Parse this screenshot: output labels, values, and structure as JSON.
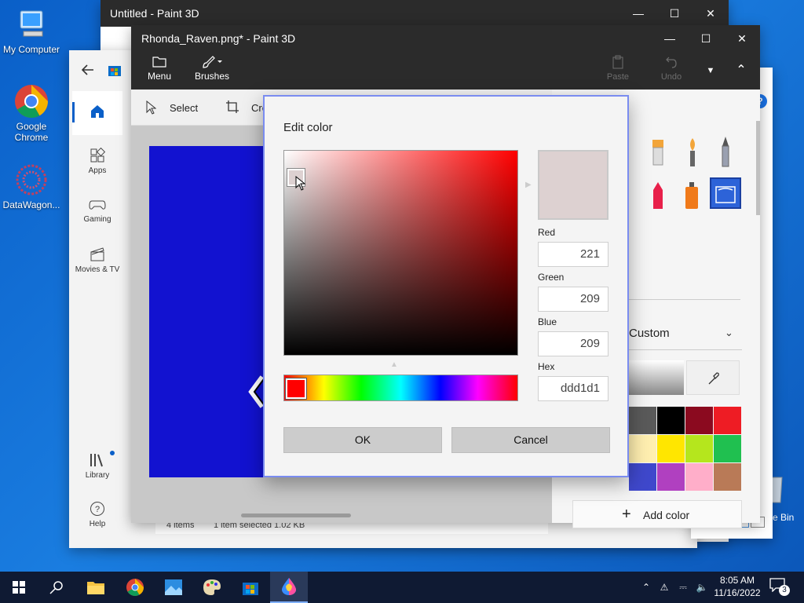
{
  "desktop": {
    "icons": [
      {
        "label": "My Computer"
      },
      {
        "label": "Google Chrome"
      },
      {
        "label": "DataWagon..."
      }
    ],
    "recycle_bin_partial": "e Bin"
  },
  "back_window": {
    "title": "Untitled - Paint 3D"
  },
  "store": {
    "rail": {
      "home": "",
      "apps": "Apps",
      "gaming": "Gaming",
      "movies": "Movies & TV",
      "library": "Library",
      "help": "Help"
    }
  },
  "explorer": {
    "status_items": "4 items",
    "status_selected": "1 item selected  1.02 KB"
  },
  "main_window": {
    "title": "Rhonda_Raven.png* - Paint 3D",
    "toolbar": {
      "menu": "Menu",
      "brushes": "Brushes",
      "paste": "Paste",
      "undo": "Undo"
    },
    "subbar": {
      "select": "Select",
      "crop": "Cro"
    },
    "sidepanel": {
      "custom_label": "Custom",
      "add_color": "Add color",
      "swatches": [
        "#5a5a5a",
        "#000000",
        "#8b0a1f",
        "#ee1c24",
        "#ffefb0",
        "#ffe600",
        "#b5e61d",
        "#20c050",
        "#3f48cc",
        "#b040c0",
        "#ffaec9",
        "#b97a57"
      ]
    },
    "canvas_color": "#1212d0"
  },
  "dialog": {
    "title": "Edit color",
    "red_label": "Red",
    "red_value": "221",
    "green_label": "Green",
    "green_value": "209",
    "blue_label": "Blue",
    "blue_value": "209",
    "hex_label": "Hex",
    "hex_value": "ddd1d1",
    "ok": "OK",
    "cancel": "Cancel",
    "current_color": "#ddd1d1"
  },
  "taskbar": {
    "time": "8:05 AM",
    "date": "11/16/2022",
    "notification_count": "3"
  }
}
